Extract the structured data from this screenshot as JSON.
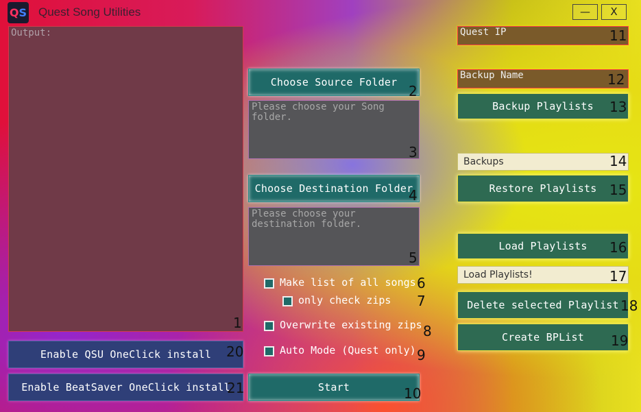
{
  "window": {
    "title": "Quest Song Utilities",
    "logo_text_q": "Q",
    "logo_text_s": "S",
    "minimize_label": "—",
    "close_label": "X"
  },
  "output": {
    "label": "Output:",
    "number": "1"
  },
  "source": {
    "button_label": "Choose Source Folder",
    "button_number": "2",
    "placeholder": "Please choose your Song folder.",
    "text_number": "3"
  },
  "destination": {
    "button_label": "Choose Destination Folder",
    "button_number": "4",
    "placeholder": "Please choose your destination folder.",
    "text_number": "5"
  },
  "options": [
    {
      "label": "Make list of all songs",
      "number": "6",
      "checked": false
    },
    {
      "label": "only check zips",
      "number": "7",
      "checked": false
    },
    {
      "label": "Overwrite existing zips",
      "number": "8",
      "checked": false
    },
    {
      "label": "Auto Mode (Quest only)",
      "number": "9",
      "checked": false
    }
  ],
  "start": {
    "label": "Start",
    "number": "10"
  },
  "quest_ip": {
    "placeholder": "Quest IP",
    "number": "11"
  },
  "backup_name": {
    "placeholder": "Backup Name",
    "number": "12"
  },
  "backup_playlists": {
    "label": "Backup Playlists",
    "number": "13"
  },
  "backups_select": {
    "value": "Backups",
    "number": "14"
  },
  "restore_playlists": {
    "label": "Restore Playlists",
    "number": "15"
  },
  "load_playlists": {
    "label": "Load Playlists",
    "number": "16"
  },
  "playlists_select": {
    "value": "Load Playlists!",
    "number": "17"
  },
  "delete_playlist": {
    "label": "Delete selected Playlist",
    "number": "18"
  },
  "create_bplist": {
    "label": "Create BPList",
    "number": "19"
  },
  "qsu_oneclick": {
    "label": "Enable QSU OneClick install",
    "number": "20"
  },
  "beatsaver_oneclick": {
    "label": "Enable BeatSaver OneClick install",
    "number": "21"
  }
}
